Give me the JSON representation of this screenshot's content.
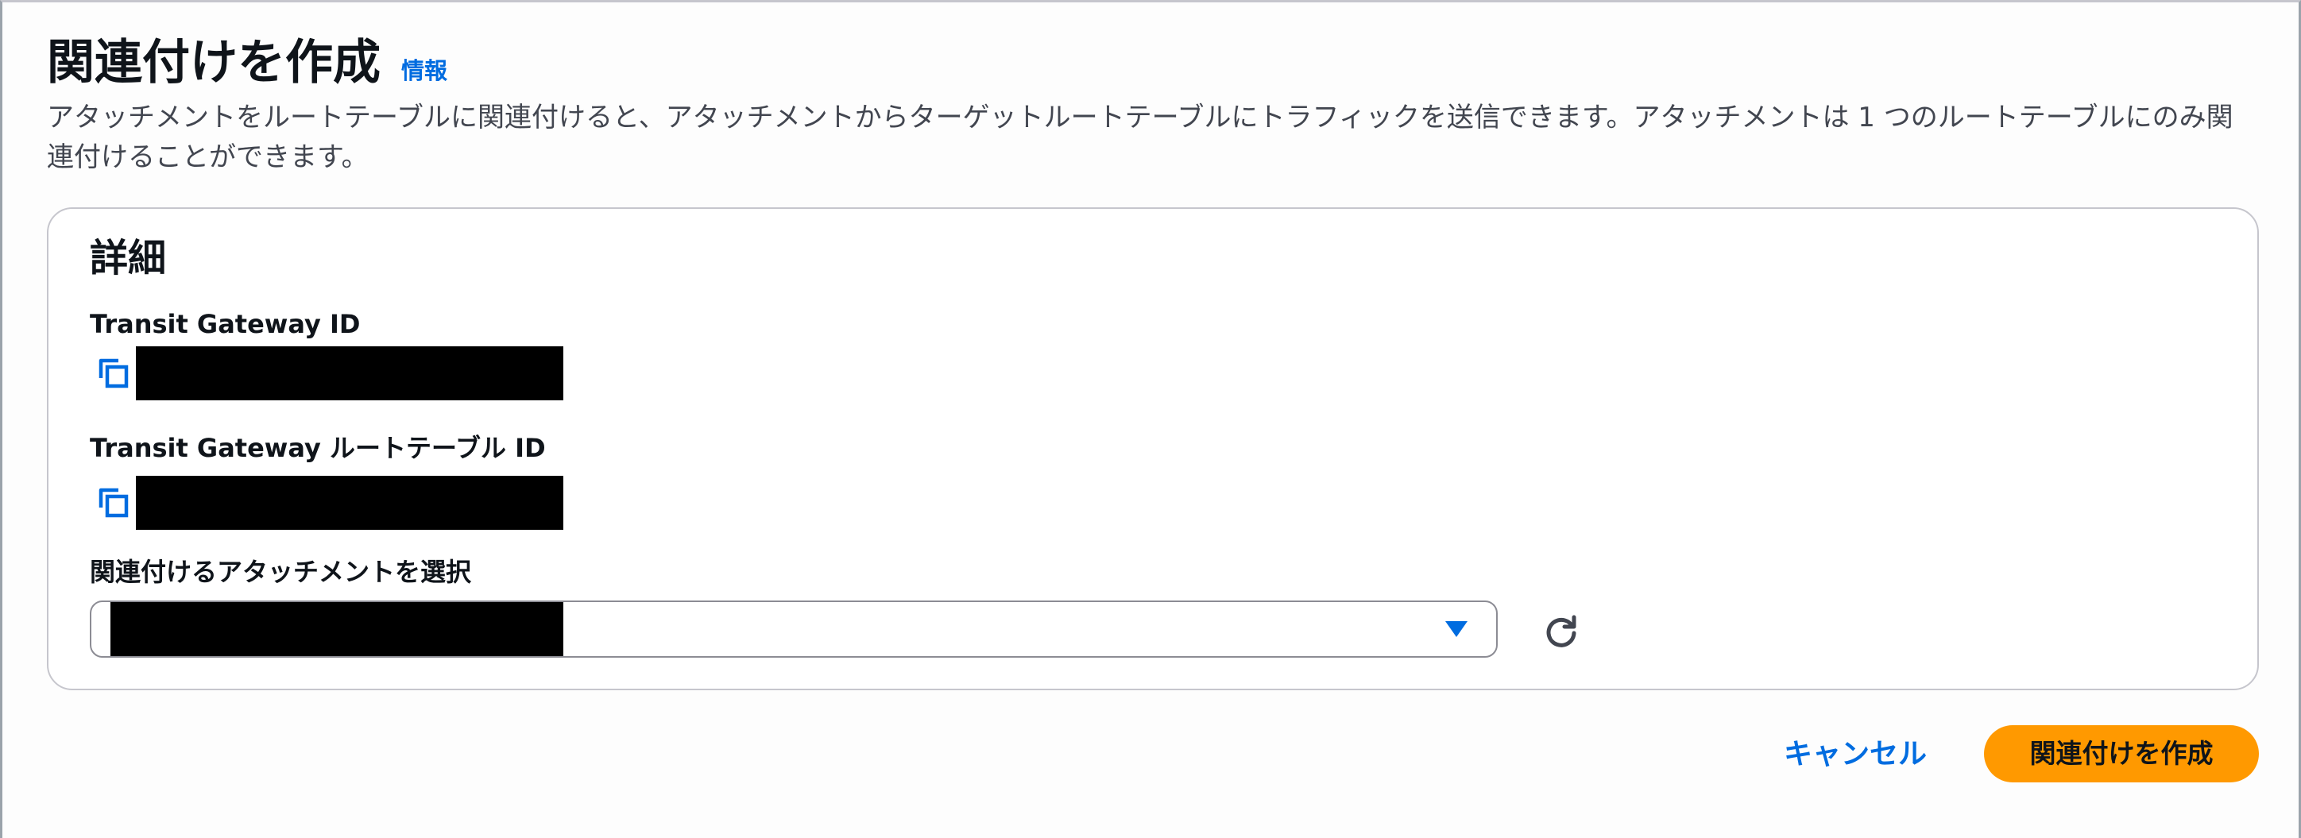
{
  "header": {
    "title": "関連付けを作成",
    "info_link": "情報",
    "description": "アタッチメントをルートテーブルに関連付けると、アタッチメントからターゲットルートテーブルにトラフィックを送信できます。アタッチメントは 1 つのルートテーブルにのみ関連付けることができます。"
  },
  "details": {
    "title": "詳細",
    "transit_gateway_id": {
      "label": "Transit Gateway ID",
      "icon": "copy-icon"
    },
    "route_table_id": {
      "label": "Transit Gateway ルートテーブル ID",
      "icon": "copy-icon"
    },
    "attachment_select": {
      "label": "関連付けるアタッチメントを選択",
      "caret_icon": "caret-down-icon",
      "refresh_icon": "refresh-icon"
    }
  },
  "footer": {
    "cancel_label": "キャンセル",
    "submit_label": "関連付けを作成"
  },
  "colors": {
    "link": "#006ce0",
    "primary_button": "#ff9900",
    "redacted": "#000000"
  }
}
